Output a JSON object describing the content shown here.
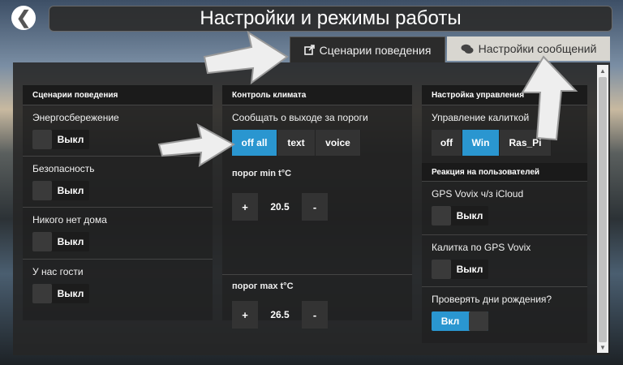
{
  "header": {
    "back_icon": "chevron-left-icon",
    "title": "Настройки и режимы работы"
  },
  "tabs": [
    {
      "label": "Сценарии поведения",
      "icon": "external-link-icon",
      "active": true
    },
    {
      "label": "Настройки сообщений",
      "icon": "comments-icon",
      "active": false
    }
  ],
  "scenarios": {
    "heading": "Сценарии поведения",
    "items": [
      {
        "label": "Энергосбережение",
        "state": "Выкл"
      },
      {
        "label": "Безопасность",
        "state": "Выкл"
      },
      {
        "label": "Никого нет дома",
        "state": "Выкл"
      },
      {
        "label": "У нас гости",
        "state": "Выкл"
      }
    ]
  },
  "climate": {
    "heading": "Контроль климата",
    "notify_label": "Сообщать о выходе за пороги",
    "notify_options": [
      "off all",
      "text",
      "voice"
    ],
    "notify_selected": "off all",
    "min_label": "порог min t°C",
    "min_value": "20.5",
    "max_label": "порог max t°C",
    "max_value": "26.5",
    "plus": "+",
    "minus": "-"
  },
  "gate": {
    "heading": "Настройка управления",
    "control_label": "Управление калиткой",
    "control_options": [
      "off",
      "Win",
      "Ras_Pi"
    ],
    "control_selected": "Win",
    "reaction_heading": "Реакция на пользователей",
    "items": [
      {
        "label": "GPS Vovix ч/з iCloud",
        "state": "Выкл"
      },
      {
        "label": "Калитка по GPS Vovix",
        "state": "Выкл"
      },
      {
        "label": "Проверять дни рождения?",
        "state": "Вкл"
      }
    ]
  },
  "colors": {
    "accent": "#2a96d0",
    "panel": "#262626"
  }
}
